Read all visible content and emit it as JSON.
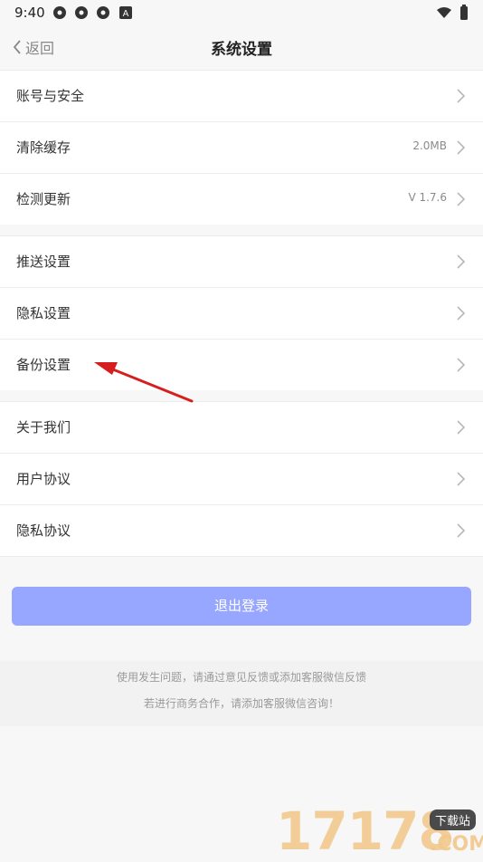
{
  "status_bar": {
    "time": "9:40"
  },
  "nav": {
    "back_label": "返回",
    "title": "系统设置"
  },
  "sections": [
    [
      {
        "label": "账号与安全",
        "value": ""
      },
      {
        "label": "清除缓存",
        "value": "2.0MB"
      },
      {
        "label": "检测更新",
        "value": "V 1.7.6"
      }
    ],
    [
      {
        "label": "推送设置",
        "value": ""
      },
      {
        "label": "隐私设置",
        "value": ""
      },
      {
        "label": "备份设置",
        "value": ""
      }
    ],
    [
      {
        "label": "关于我们",
        "value": ""
      },
      {
        "label": "用户协议",
        "value": ""
      },
      {
        "label": "隐私协议",
        "value": ""
      }
    ]
  ],
  "logout": {
    "label": "退出登录"
  },
  "footer": {
    "line1": "使用发生问题，请通过意见反馈或添加客服微信反馈",
    "line2": "若进行商务合作，请添加客服微信咨询！"
  },
  "watermark": {
    "number": "17178",
    "badge": "下载站",
    "com": ".COM"
  },
  "colors": {
    "accent": "#97a7ff",
    "annotation": "#d71e1e",
    "background": "#f7f7f7"
  },
  "icons": {
    "status": [
      "settings-icon",
      "settings-icon",
      "settings-icon",
      "a-icon"
    ],
    "status_right": [
      "wifi-icon",
      "battery-icon"
    ],
    "nav_back": "chevron-left-icon",
    "row_arrow": "chevron-right-icon",
    "annotation": "red-arrow-icon"
  }
}
